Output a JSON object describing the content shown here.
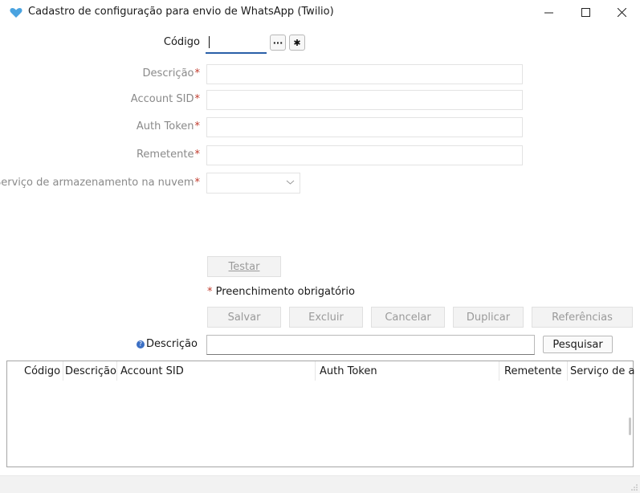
{
  "window": {
    "title": "Cadastro de configuração para envio de WhatsApp (Twilio)",
    "app_icon": "heart-icon",
    "minimize_glyph": "—",
    "maximize_glyph": "☐",
    "close_glyph": "✕"
  },
  "form": {
    "codigo_label": "Código",
    "codigo_value": "",
    "lookup_glyph": "···",
    "new_glyph": "✱",
    "descricao_label": "Descrição",
    "account_sid_label": "Account SID",
    "auth_token_label": "Auth Token",
    "remetente_label": "Remetente",
    "armazenamento_label": "Serviço de armazenamento na nuvem",
    "armazenamento_value": "",
    "required_mark": "*"
  },
  "actions": {
    "testar": "Testar",
    "required_note": "Preenchimento obrigatório",
    "salvar": "Salvar",
    "excluir": "Excluir",
    "cancelar": "Cancelar",
    "duplicar": "Duplicar",
    "referencias": "Referências"
  },
  "search": {
    "label": "Descrição",
    "help_glyph": "?",
    "value": "",
    "button": "Pesquisar"
  },
  "grid": {
    "columns": [
      "Código",
      "Descrição",
      "Account SID",
      "Auth Token",
      "Remetente",
      "Serviço de a"
    ],
    "rows": []
  },
  "colors": {
    "accent": "#2a5fa8",
    "required": "#c0392b",
    "disabled_text": "#9a9a9a"
  }
}
